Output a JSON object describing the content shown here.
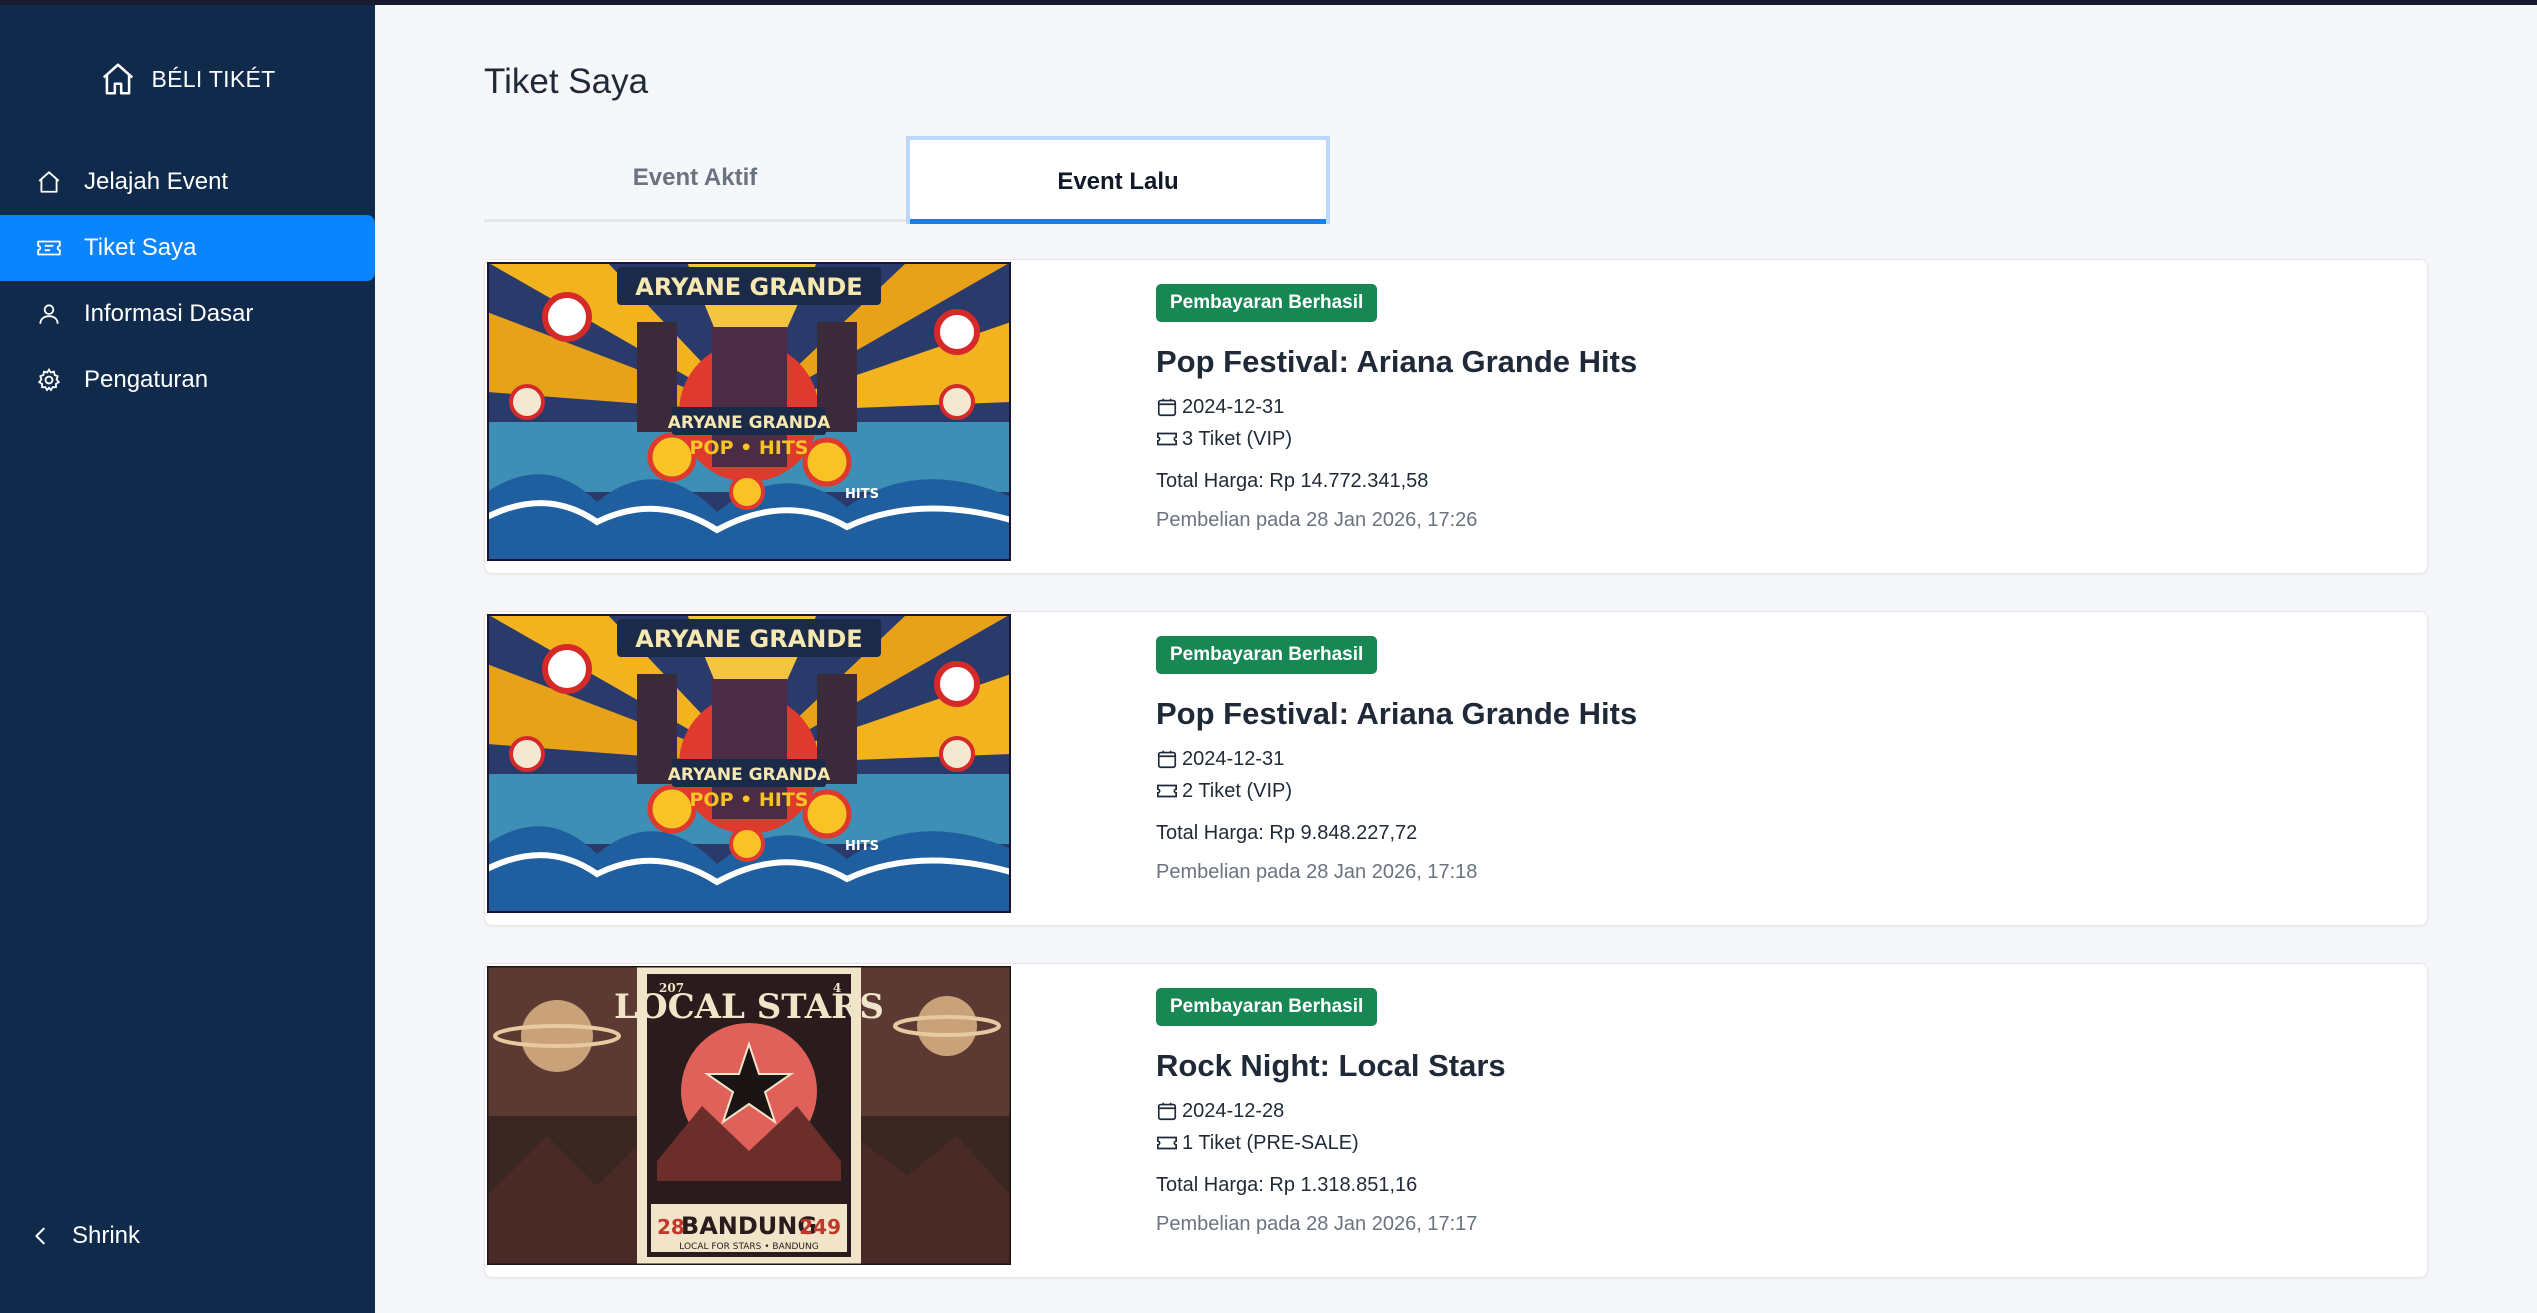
{
  "app": {
    "brand": "BÉLI TIKÉT"
  },
  "sidebar": {
    "items": [
      {
        "label": "Jelajah Event",
        "icon": "home-icon"
      },
      {
        "label": "Tiket Saya",
        "icon": "ticket-icon",
        "active": true
      },
      {
        "label": "Informasi Dasar",
        "icon": "user-icon"
      },
      {
        "label": "Pengaturan",
        "icon": "gear-icon"
      }
    ],
    "shrink_label": "Shrink"
  },
  "main": {
    "title": "Tiket Saya",
    "tabs": [
      {
        "label": "Event Aktif",
        "active": false
      },
      {
        "label": "Event Lalu",
        "active": true
      }
    ],
    "tickets": [
      {
        "status": "Pembayaran Berhasil",
        "title": "Pop Festival: Ariana Grande Hits",
        "date": "2024-12-31",
        "tickets": "3 Tiket (VIP)",
        "price": "Total Harga: Rp 14.772.341,58",
        "purchased": "Pembelian pada 28 Jan 2026, 17:26",
        "image": "pop-festival-poster"
      },
      {
        "status": "Pembayaran Berhasil",
        "title": "Pop Festival: Ariana Grande Hits",
        "date": "2024-12-31",
        "tickets": "2 Tiket (VIP)",
        "price": "Total Harga: Rp 9.848.227,72",
        "purchased": "Pembelian pada 28 Jan 2026, 17:18",
        "image": "pop-festival-poster"
      },
      {
        "status": "Pembayaran Berhasil",
        "title": "Rock Night: Local Stars",
        "date": "2024-12-28",
        "tickets": "1 Tiket (PRE-SALE)",
        "price": "Total Harga: Rp 1.318.851,16",
        "purchased": "Pembelian pada 28 Jan 2026, 17:17",
        "image": "rock-night-poster"
      }
    ]
  },
  "posters": {
    "pop": {
      "banner": "ARYANE GRANDE",
      "center": "ARYANE GRANDA",
      "sub": "POP • HITS",
      "side": "HITS"
    },
    "rock": {
      "top_left": "207",
      "top_right": "4",
      "title": "LOCAL STARS",
      "city": "BANDUNG",
      "num_left": "28",
      "num_right": "249",
      "footer": "LOCAL FOR STARS • BANDUNG"
    }
  },
  "colors": {
    "sidebar_bg": "#0f2a4a",
    "accent": "#0a84ff",
    "badge": "#198754"
  }
}
